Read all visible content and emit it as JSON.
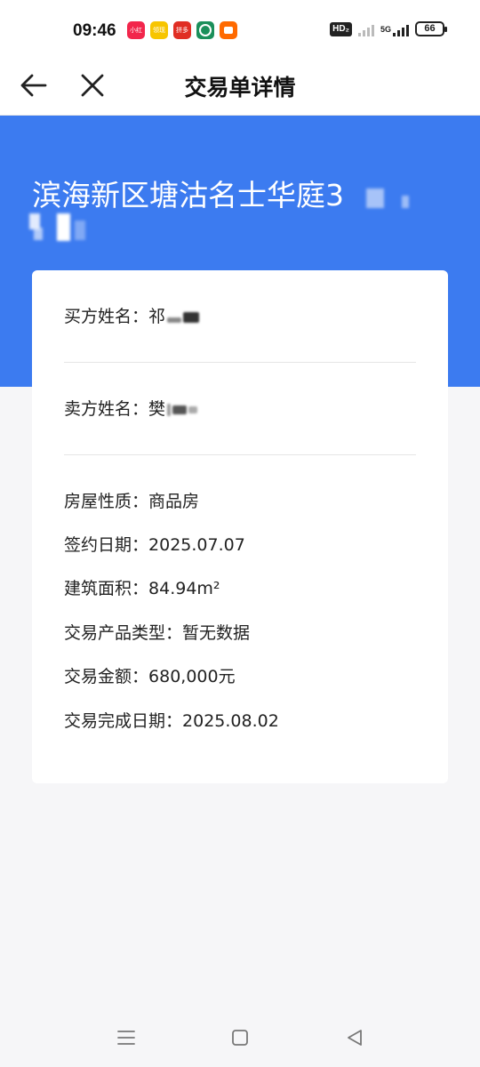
{
  "status_bar": {
    "time": "09:46",
    "app_icons": [
      {
        "name": "xiaohongshu-app-icon",
        "label": "小红书",
        "color": "#f2264b"
      },
      {
        "name": "meituan-app-icon",
        "label": "领现金",
        "color": "#f7c500"
      },
      {
        "name": "pinduoduo-app-icon",
        "label": "拼多",
        "color": "#e02e24"
      },
      {
        "name": "bank-app-icon",
        "label": "",
        "color": "#1b8f5a"
      },
      {
        "name": "reward-app-icon",
        "label": "",
        "color": "#ff6a00"
      }
    ],
    "hd_label": "HD₂",
    "network_label": "5G",
    "battery": "66"
  },
  "nav": {
    "title": "交易单详情"
  },
  "header": {
    "property_name": "滨海新区塘沽名士华庭3"
  },
  "details": {
    "buyer_label": "买方姓名：",
    "buyer_value": "祁",
    "seller_label": "卖方姓名：",
    "seller_value": "樊",
    "property_type_label": "房屋性质：",
    "property_type_value": "商品房",
    "sign_date_label": "签约日期：",
    "sign_date_value": "2025.07.07",
    "area_label": "建筑面积：",
    "area_value": "84.94m²",
    "product_type_label": "交易产品类型：",
    "product_type_value": "暂无数据",
    "amount_label": "交易金额：",
    "amount_value": "680,000元",
    "complete_date_label": "交易完成日期：",
    "complete_date_value": "2025.08.02"
  },
  "colors": {
    "accent": "#3c7bf0",
    "card": "#ffffff",
    "page_bg": "#f6f6f8"
  }
}
